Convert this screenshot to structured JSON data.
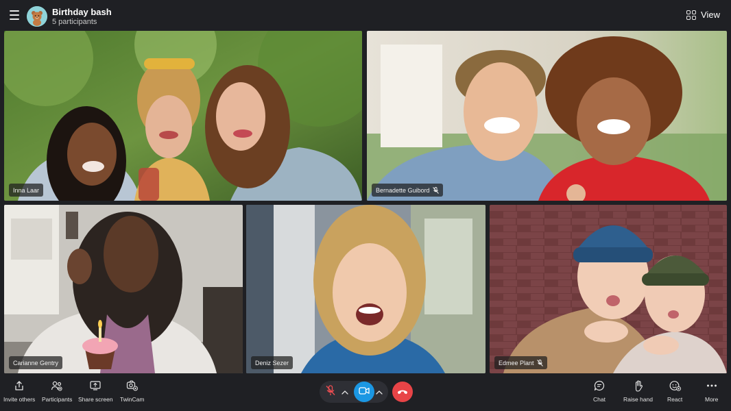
{
  "header": {
    "title": "Birthday bash",
    "subtitle": "5 participants",
    "view_label": "View",
    "menu_icon": "hamburger-menu-icon",
    "avatar_icon": "teddy-bear-avatar"
  },
  "participants": [
    {
      "name": "Inna Laar",
      "muted": false
    },
    {
      "name": "Bernadette Guibord",
      "muted": true
    },
    {
      "name": "Carianne Gentry",
      "muted": false
    },
    {
      "name": "Deniz Sezer",
      "muted": false
    },
    {
      "name": "Edmee Plant",
      "muted": true
    }
  ],
  "toolbar": {
    "left": [
      {
        "label": "Invite others",
        "icon": "share-upload-icon"
      },
      {
        "label": "Participants",
        "icon": "participants-icon"
      },
      {
        "label": "Share screen",
        "icon": "share-screen-icon"
      },
      {
        "label": "TwinCam",
        "icon": "twincam-icon"
      }
    ],
    "right": [
      {
        "label": "Chat",
        "icon": "chat-icon"
      },
      {
        "label": "Raise hand",
        "icon": "raise-hand-icon"
      },
      {
        "label": "React",
        "icon": "react-emoji-icon"
      },
      {
        "label": "More",
        "icon": "more-dots-icon"
      }
    ],
    "center": {
      "mic_state": "muted",
      "video_state": "on",
      "end_call_color": "#e84447",
      "video_color": "#1b97e3"
    }
  },
  "colors": {
    "background": "#1f2024",
    "accent": "#1b97e3",
    "end_call": "#e84447"
  }
}
